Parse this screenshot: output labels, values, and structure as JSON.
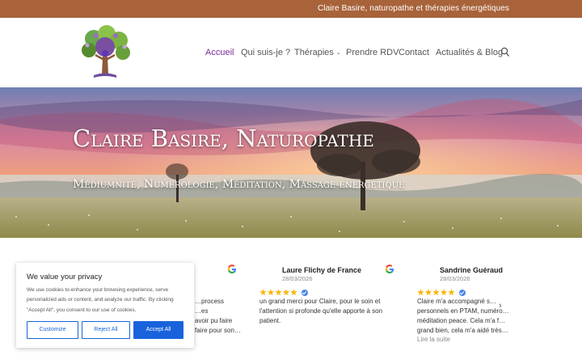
{
  "topbar": {
    "text": "Claire Basire, naturopathe et thérapies énergétiques",
    "background": "#a8633a"
  },
  "header": {
    "logo": {
      "name": "tree-of-life-logo"
    },
    "nav": [
      {
        "label": "Accueil",
        "active": true
      },
      {
        "label": "Qui suis-je ?",
        "active": false
      },
      {
        "label": "Thérapies",
        "active": false,
        "dropdown": true
      },
      {
        "label": "Prendre RDV",
        "active": false
      },
      {
        "label": "Contact",
        "active": false
      },
      {
        "label": "Actualités & Blog",
        "active": false
      }
    ],
    "search_icon": "search-icon",
    "accent": "#7a2f9a"
  },
  "hero": {
    "title": "Claire Basire, Naturopathe",
    "subtitle": "Médiumnité, Numérologie, Méditation, Massage énergétique"
  },
  "reviews": {
    "items": [
      {
        "name": "",
        "date": "",
        "text_lines": [
          "…process",
          "…es",
          "avoir pu faire",
          "faire pour son…"
        ]
      },
      {
        "name": "Laure Flichy de France",
        "date": "28/03/2026",
        "rating": 5,
        "text": "un grand merci pour Claire, pour le soin et l'attention si profonde qu'elle apporte à son patient."
      },
      {
        "name": "Sandrine Guéraud",
        "date": "28/03/2026",
        "rating": 5,
        "text_lines": [
          "Claire m'a accompagné s…",
          "personnels en PTAM, numéro…",
          "méditation peace. Cela m'a f…",
          "grand bien, cela m'a aidé très…"
        ],
        "read_more": "Lire la suite"
      }
    ],
    "next_icon": "chevron-right-icon"
  },
  "cookie_banner": {
    "title": "We value your privacy",
    "body": "We use cookies to enhance your browsing experience, serve personalized ads or content, and analyze our traffic. By clicking \"Accept All\", you consent to our use of cookies.",
    "buttons": {
      "customize": "Customize",
      "reject": "Reject All",
      "accept": "Accept All"
    },
    "accent": "#1863dc"
  }
}
